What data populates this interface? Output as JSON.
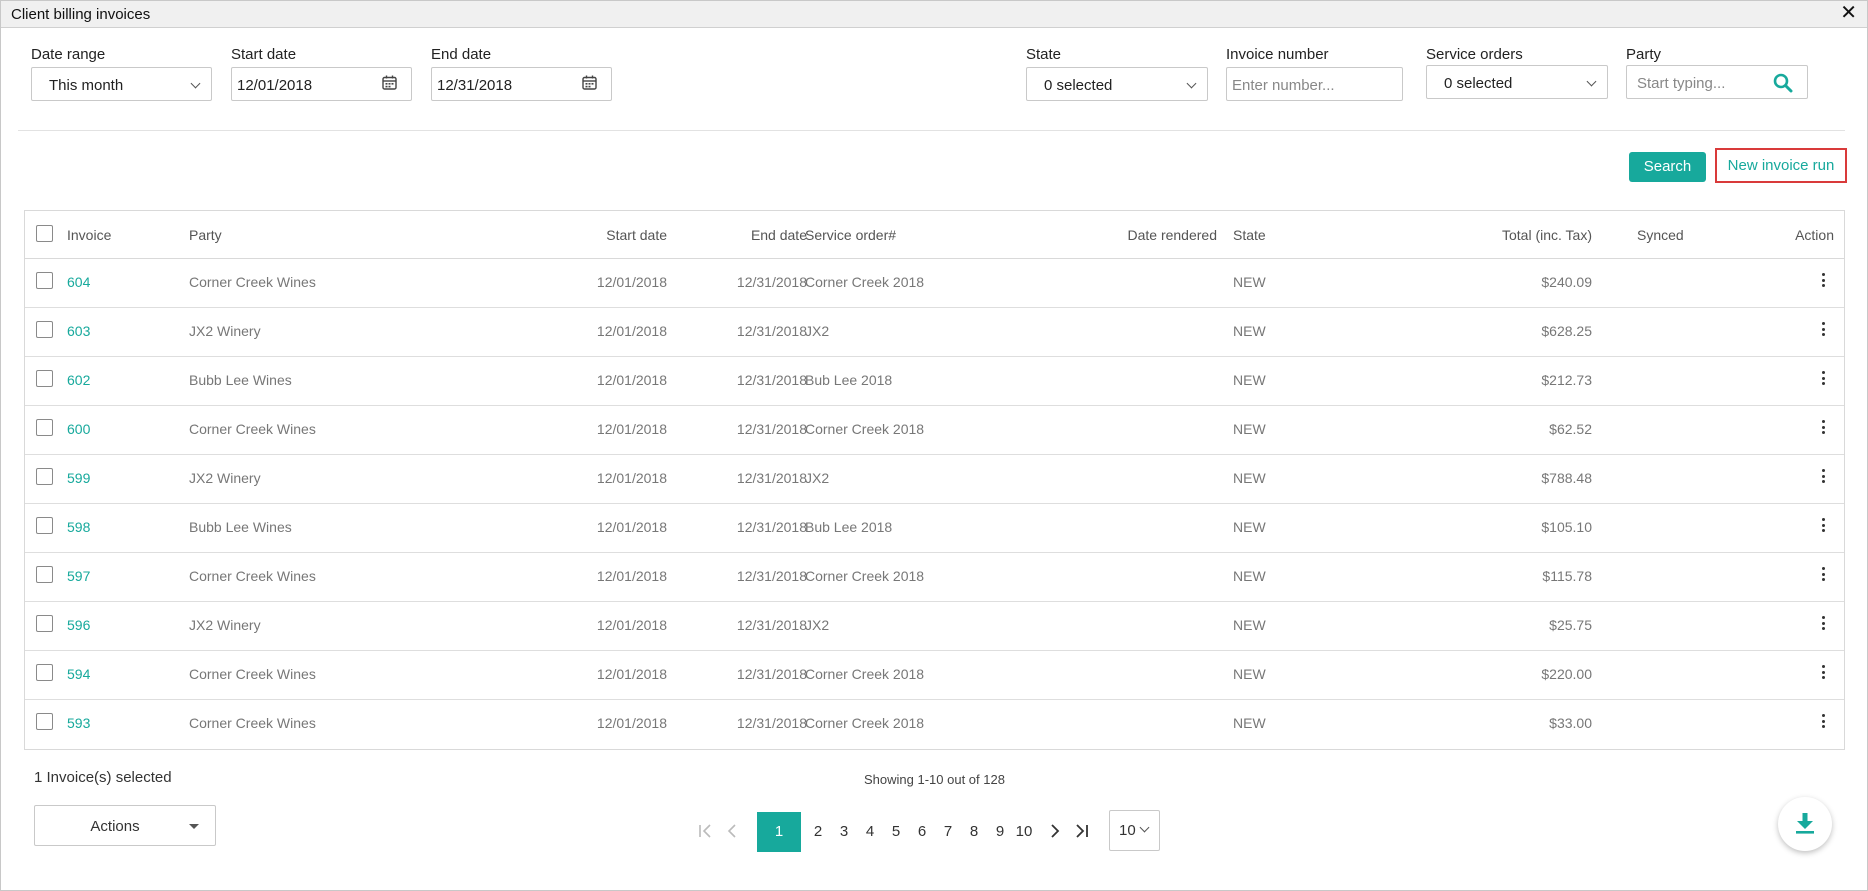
{
  "window": {
    "title": "Client billing invoices",
    "close_glyph": "✕"
  },
  "filters": {
    "date_range": {
      "label": "Date range",
      "value": "This month"
    },
    "start_date": {
      "label": "Start date",
      "value": "12/01/2018"
    },
    "end_date": {
      "label": "End date",
      "value": "12/31/2018"
    },
    "state": {
      "label": "State",
      "value": "0 selected"
    },
    "invoice_number": {
      "label": "Invoice number",
      "placeholder": "Enter number..."
    },
    "service_orders": {
      "label": "Service orders",
      "value": "0 selected"
    },
    "party": {
      "label": "Party",
      "placeholder": "Start typing..."
    }
  },
  "toolbar": {
    "search_label": "Search",
    "new_run_label": "New invoice run"
  },
  "table": {
    "headers": {
      "invoice": "Invoice",
      "party": "Party",
      "start": "Start date",
      "end": "End date",
      "service": "Service order#",
      "rendered": "Date rendered",
      "state": "State",
      "total": "Total (inc. Tax)",
      "synced": "Synced",
      "action": "Action"
    },
    "rows": [
      {
        "invoice": "604",
        "party": "Corner Creek Wines",
        "start": "12/01/2018",
        "end": "12/31/2018",
        "service": "Corner Creek 2018",
        "rendered": "",
        "state": "NEW",
        "total": "$240.09",
        "synced": ""
      },
      {
        "invoice": "603",
        "party": "JX2 Winery",
        "start": "12/01/2018",
        "end": "12/31/2018",
        "service": "JX2",
        "rendered": "",
        "state": "NEW",
        "total": "$628.25",
        "synced": ""
      },
      {
        "invoice": "602",
        "party": "Bubb Lee Wines",
        "start": "12/01/2018",
        "end": "12/31/2018",
        "service": "Bub Lee 2018",
        "rendered": "",
        "state": "NEW",
        "total": "$212.73",
        "synced": ""
      },
      {
        "invoice": "600",
        "party": "Corner Creek Wines",
        "start": "12/01/2018",
        "end": "12/31/2018",
        "service": "Corner Creek 2018",
        "rendered": "",
        "state": "NEW",
        "total": "$62.52",
        "synced": ""
      },
      {
        "invoice": "599",
        "party": "JX2 Winery",
        "start": "12/01/2018",
        "end": "12/31/2018",
        "service": "JX2",
        "rendered": "",
        "state": "NEW",
        "total": "$788.48",
        "synced": ""
      },
      {
        "invoice": "598",
        "party": "Bubb Lee Wines",
        "start": "12/01/2018",
        "end": "12/31/2018",
        "service": "Bub Lee 2018",
        "rendered": "",
        "state": "NEW",
        "total": "$105.10",
        "synced": ""
      },
      {
        "invoice": "597",
        "party": "Corner Creek Wines",
        "start": "12/01/2018",
        "end": "12/31/2018",
        "service": "Corner Creek 2018",
        "rendered": "",
        "state": "NEW",
        "total": "$115.78",
        "synced": ""
      },
      {
        "invoice": "596",
        "party": "JX2 Winery",
        "start": "12/01/2018",
        "end": "12/31/2018",
        "service": "JX2",
        "rendered": "",
        "state": "NEW",
        "total": "$25.75",
        "synced": ""
      },
      {
        "invoice": "594",
        "party": "Corner Creek Wines",
        "start": "12/01/2018",
        "end": "12/31/2018",
        "service": "Corner Creek 2018",
        "rendered": "",
        "state": "NEW",
        "total": "$220.00",
        "synced": ""
      },
      {
        "invoice": "593",
        "party": "Corner Creek Wines",
        "start": "12/01/2018",
        "end": "12/31/2018",
        "service": "Corner Creek 2018",
        "rendered": "",
        "state": "NEW",
        "total": "$33.00",
        "synced": ""
      }
    ]
  },
  "footer": {
    "selected_text": "1 Invoice(s) selected",
    "actions_label": "Actions",
    "showing_text": "Showing 1-10 out of 128",
    "pages": [
      "1",
      "2",
      "3",
      "4",
      "5",
      "6",
      "7",
      "8",
      "9",
      "10"
    ],
    "current_page": "1",
    "page_size": "10"
  },
  "icons": {
    "calendar": "calendar-icon",
    "search": "search-icon",
    "kebab": "kebab-menu-icon",
    "download": "download-icon",
    "first": "first-page-icon",
    "prev": "prev-page-icon",
    "next": "next-page-icon",
    "last": "last-page-icon"
  },
  "colors": {
    "accent": "#17a99c",
    "highlight": "#d93a3a"
  }
}
